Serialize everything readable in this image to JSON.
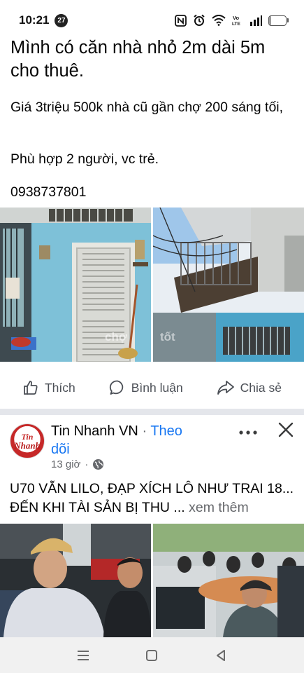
{
  "status_bar": {
    "time": "10:21",
    "notification_count": "27",
    "network": "Vo LTE",
    "battery_level": "13"
  },
  "post1": {
    "title": "Mình có căn nhà nhỏ 2m dài 5m cho thuê.",
    "line1": "Giá 3triệu 500k nhà cũ gần chợ 200 sáng tối,",
    "line2": "Phù hợp 2 người, vc trẻ.",
    "line3": "0938737801",
    "watermark": "chợ tốt"
  },
  "actions": {
    "like": "Thích",
    "comment": "Bình luận",
    "share": "Chia sẻ"
  },
  "post2": {
    "page_name": "Tin Nhanh VN",
    "separator": "·",
    "follow_part1": "Theo",
    "follow_part2": "dõi",
    "time": "13 giờ",
    "body": "U70 VẪN LILO, ĐẠP XÍCH LÔ NHƯ TRAI 18... ĐẾN KHI TÀI SẢN BỊ THU ...",
    "see_more": "xem thêm",
    "avatar_line1": "Tin",
    "avatar_line2": "Nhanh"
  },
  "colors": {
    "link_blue": "#1877f2",
    "text_primary": "#050505",
    "text_secondary": "#65676b",
    "divider": "#e4e6eb"
  }
}
